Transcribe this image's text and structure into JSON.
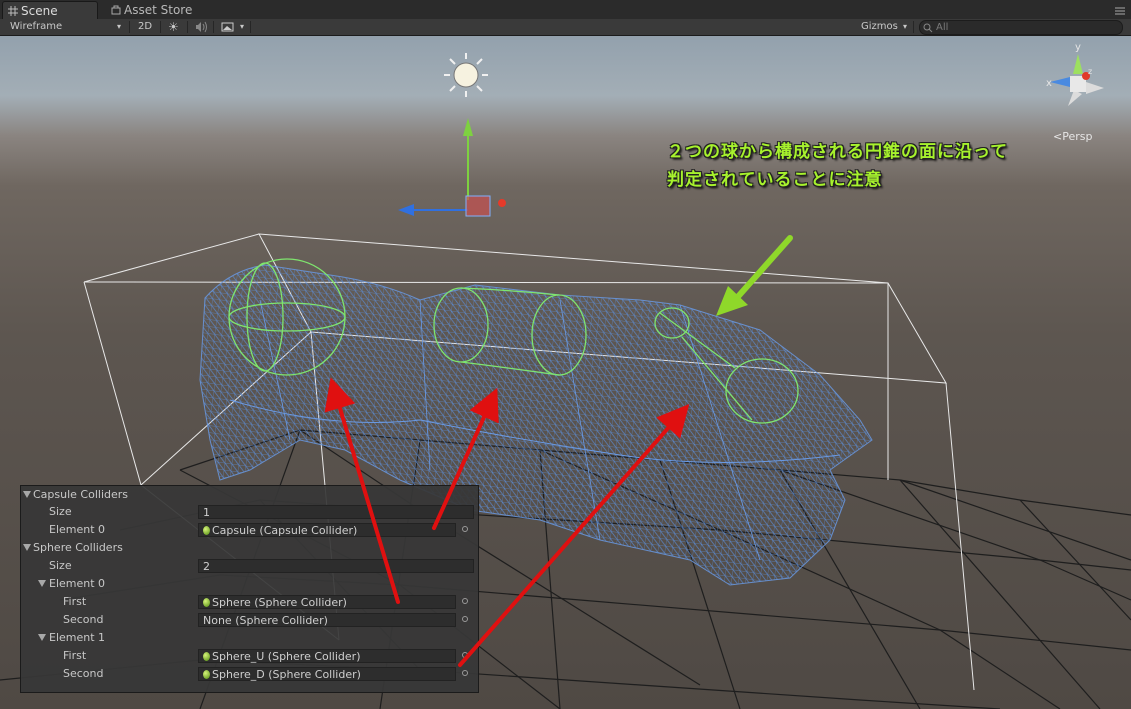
{
  "tabs": [
    {
      "label": "Scene",
      "icon": "grid-icon",
      "active": true
    },
    {
      "label": "Asset Store",
      "icon": "store-icon",
      "active": false
    }
  ],
  "toolbar": {
    "draw_mode": "Wireframe",
    "mode_2d": "2D",
    "gizmos_label": "Gizmos",
    "search_placeholder": "All"
  },
  "gizmo": {
    "y_label": "y",
    "x_label": "x",
    "z_label": "z",
    "projection": "Persp"
  },
  "annotation": {
    "line1": "２つの球から構成される円錐の面に沿って",
    "line2": "判定されていることに注意"
  },
  "inspector": {
    "capsule_header": "Capsule Colliders",
    "capsule_size_label": "Size",
    "capsule_size_value": "1",
    "capsule_el0_label": "Element 0",
    "capsule_el0_value": "Capsule (Capsule Collider)",
    "sphere_header": "Sphere Colliders",
    "sphere_size_label": "Size",
    "sphere_size_value": "2",
    "el0_header": "Element 0",
    "el0_first_label": "First",
    "el0_first_value": "Sphere (Sphere Collider)",
    "el0_second_label": "Second",
    "el0_second_value": "None (Sphere Collider)",
    "el1_header": "Element 1",
    "el1_first_label": "First",
    "el1_first_value": "Sphere_U (Sphere Collider)",
    "el1_second_label": "Second",
    "el1_second_value": "Sphere_D (Sphere Collider)"
  },
  "colors": {
    "annotation_text": "#a7f22d",
    "arrow_red": "#e01010",
    "arrow_green": "#8fd82a",
    "cloth_wire": "#5c8fdc",
    "collider_wire": "#7fe56e"
  }
}
